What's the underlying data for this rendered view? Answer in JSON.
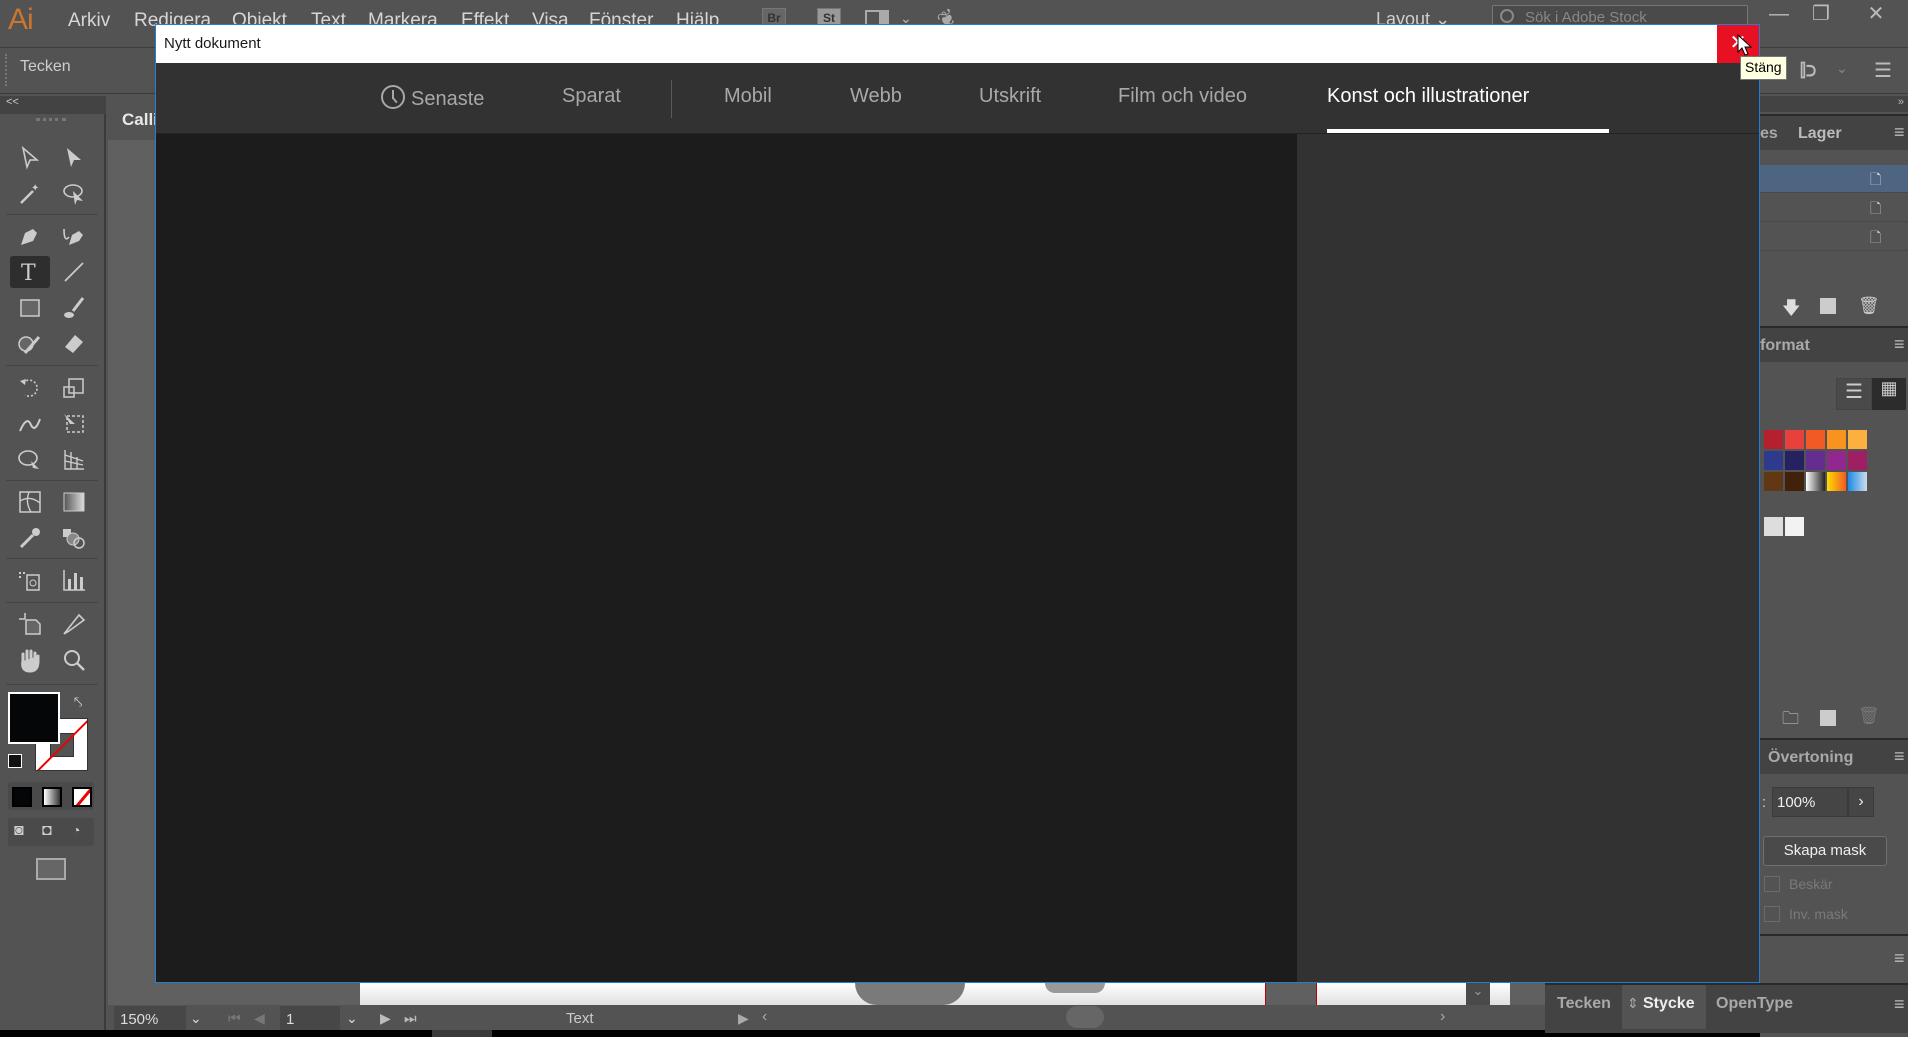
{
  "app": {
    "logo": "Ai",
    "menu": [
      "Arkiv",
      "Redigera",
      "Objekt",
      "Text",
      "Markera",
      "Effekt",
      "Visa",
      "Fönster",
      "Hjälp"
    ],
    "app_icons": [
      "Br",
      "St"
    ],
    "workspace": "Layout",
    "search_placeholder": "Sök i Adobe Stock",
    "window_controls": {
      "minimize": "—",
      "restore": "❐",
      "close": "✕"
    }
  },
  "control_bar": {
    "label": "Tecken"
  },
  "document": {
    "tab_label": "Calli"
  },
  "toolbar": {
    "collapse": "<<",
    "tools": [
      "selection",
      "direct-selection",
      "magic-wand",
      "lasso",
      "pen",
      "curvature",
      "type",
      "line-segment",
      "rectangle",
      "paintbrush",
      "shaper",
      "eraser",
      "rotate",
      "scale",
      "warp",
      "free-transform",
      "shape-builder",
      "perspective-grid",
      "mesh",
      "gradient",
      "eyedropper",
      "blend",
      "symbol-sprayer",
      "column-graph",
      "artboard",
      "slice",
      "hand",
      "zoom"
    ],
    "active_tool": "type",
    "fill_color": "#050608",
    "stroke_color": "none"
  },
  "status_bar": {
    "zoom": "150%",
    "artboard_number": "1",
    "tool_name": "Text"
  },
  "right_panels": {
    "layers": {
      "tabs": [
        "es",
        "Lager"
      ],
      "rows": 3
    },
    "swatches": {
      "tab": "format",
      "colors_row1": [
        "#b51f2e",
        "#e8403a",
        "#f15a24",
        "#f7931e",
        "#fbb040"
      ],
      "colors_row2": [
        "#2e3a8c",
        "#262262",
        "#662d91",
        "#92278f",
        "#9e1f63"
      ],
      "colors_row3": [
        "#603813",
        "#42210b",
        "gradient-gray",
        "gradient-yellow",
        "gradient-blue"
      ]
    },
    "transparency": {
      "tab": "Övertoning",
      "opacity": "100%",
      "make_mask": "Skapa mask",
      "clip": "Beskär",
      "invert_mask": "Inv. mask"
    },
    "bottom_tabs": [
      "Tecken",
      "Stycke",
      "OpenType"
    ]
  },
  "dialog": {
    "title": "Nytt dokument",
    "close_tooltip": "Stäng",
    "tabs": [
      {
        "label": "Senaste",
        "icon": "clock-icon"
      },
      {
        "label": "Sparat"
      },
      {
        "label": "Mobil"
      },
      {
        "label": "Webb"
      },
      {
        "label": "Utskrift"
      },
      {
        "label": "Film och video"
      },
      {
        "label": "Konst och illustrationer",
        "active": true
      }
    ]
  }
}
